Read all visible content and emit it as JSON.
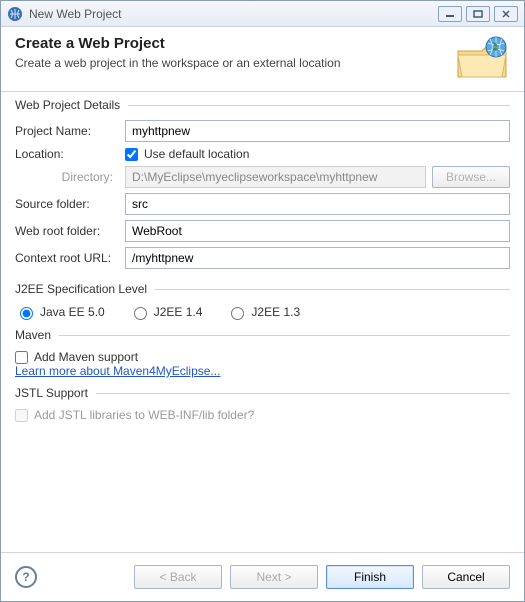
{
  "window": {
    "title": "New Web Project"
  },
  "header": {
    "title": "Create a Web Project",
    "subtitle": "Create a web project in the workspace or an external location"
  },
  "details": {
    "section_title": "Web Project Details",
    "labels": {
      "project_name": "Project Name:",
      "location": "Location:",
      "use_default": "Use default location",
      "directory": "Directory:",
      "browse": "Browse...",
      "source_folder": "Source folder:",
      "web_root": "Web root folder:",
      "context_root": "Context root URL:"
    },
    "values": {
      "project_name": "myhttpnew",
      "directory": "D:\\MyEclipse\\myeclipseworkspace\\myhttpnew",
      "source_folder": "src",
      "web_root": "WebRoot",
      "context_root": "/myhttpnew"
    }
  },
  "j2ee": {
    "section_title": "J2EE Specification Level",
    "options": {
      "ee5": "Java EE 5.0",
      "ee14": "J2EE 1.4",
      "ee13": "J2EE 1.3"
    }
  },
  "maven": {
    "section_title": "Maven",
    "add_support": "Add Maven support",
    "link": "Learn more about Maven4MyEclipse..."
  },
  "jstl": {
    "section_title": "JSTL Support",
    "add_jstl": "Add JSTL libraries to WEB-INF/lib folder?"
  },
  "footer": {
    "back": "< Back",
    "next": "Next >",
    "finish": "Finish",
    "cancel": "Cancel"
  }
}
